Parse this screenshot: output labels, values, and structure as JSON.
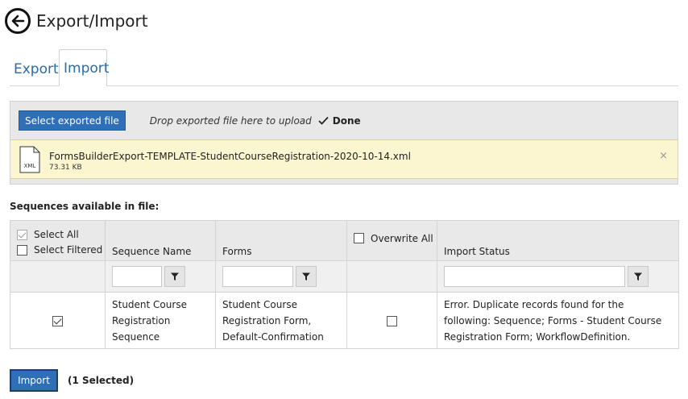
{
  "header": {
    "title": "Export/Import"
  },
  "tabs": [
    {
      "label": "Export",
      "active": false
    },
    {
      "label": "Import",
      "active": true
    }
  ],
  "upload": {
    "select_button": "Select exported file",
    "drop_text": "Drop exported file here to upload",
    "status": "Done",
    "file": {
      "icon_label": "XML",
      "name": "FormsBuilderExport-TEMPLATE-StudentCourseRegistration-2020-10-14.xml",
      "size": "73.31 KB"
    },
    "remove_symbol": "×"
  },
  "sequences_label": "Sequences available in file:",
  "table": {
    "select_all_label": "Select All",
    "select_filtered_label": "Select Filtered",
    "columns": {
      "sequence_name": "Sequence Name",
      "forms": "Forms",
      "overwrite_all": "Overwrite All",
      "import_status": "Import Status"
    },
    "rows": [
      {
        "selected": true,
        "sequence_name": "Student Course Registration Sequence",
        "forms": "Student Course Registration Form, Default-Confirmation",
        "overwrite": false,
        "import_status": "Error. Duplicate records found for the following: Sequence; Forms - Student Course Registration Form; WorkflowDefinition."
      }
    ]
  },
  "footer": {
    "import_button": "Import",
    "selected_count": "(1 Selected)"
  },
  "colors": {
    "accent": "#2e6fb8",
    "link": "#2a6ba8",
    "file_row_bg": "#fbf6cf"
  }
}
